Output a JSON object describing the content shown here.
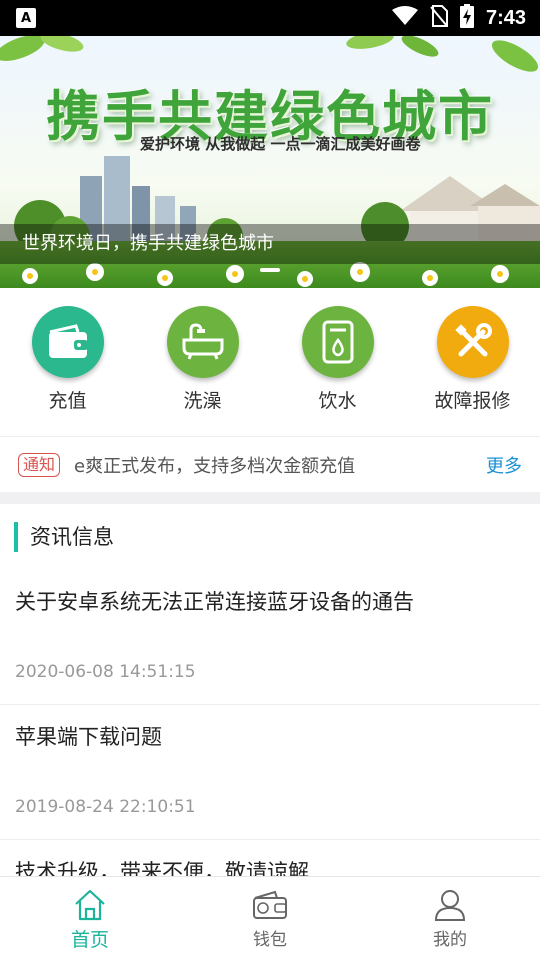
{
  "status_bar": {
    "time": "7:43",
    "notification_icon": "a-icon",
    "icons": [
      "wifi-icon",
      "no-sim-icon",
      "battery-charging-icon"
    ]
  },
  "banner": {
    "title": "携手共建绿色城市",
    "slogan": "爱护环境 从我做起 一点一滴汇成美好画卷",
    "caption": "世界环境日，携手共建绿色城市"
  },
  "quick_menu": [
    {
      "label": "充值",
      "icon": "wallet-icon",
      "color": "#2bb88f"
    },
    {
      "label": "洗澡",
      "icon": "bathtub-icon",
      "color": "#6db33f"
    },
    {
      "label": "饮水",
      "icon": "water-heater-icon",
      "color": "#6db33f"
    },
    {
      "label": "故障报修",
      "icon": "repair-tools-icon",
      "color": "#f2ab0f"
    }
  ],
  "notice": {
    "tag": "通知",
    "text": "e爽正式发布，支持多档次金额充值",
    "more": "更多"
  },
  "news": {
    "section_title": "资讯信息",
    "items": [
      {
        "title": "关于安卓系统无法正常连接蓝牙设备的通告",
        "date": "2020-06-08 14:51:15"
      },
      {
        "title": "苹果端下载问题",
        "date": "2019-08-24 22:10:51"
      },
      {
        "title": "技术升级，带来不便，敬请谅解",
        "date": ""
      }
    ]
  },
  "tabbar": [
    {
      "label": "首页",
      "icon": "home-icon",
      "active": true
    },
    {
      "label": "钱包",
      "icon": "wallet-tab-icon",
      "active": false
    },
    {
      "label": "我的",
      "icon": "user-icon",
      "active": false
    }
  ],
  "colors": {
    "accent": "#1cb49a",
    "notice_red": "#d9534f",
    "link_blue": "#1a90d8"
  }
}
